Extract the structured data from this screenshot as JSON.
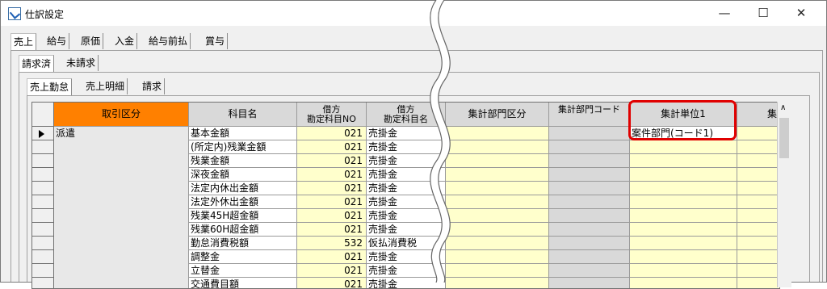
{
  "window": {
    "title": "仕訳設定",
    "minimize": "—",
    "maximize": "☐",
    "close": "✕"
  },
  "tabs_level1": [
    "売上",
    "給与",
    "原価",
    "入金",
    "給与前払",
    "賞与"
  ],
  "tabs_level2": [
    "請求済",
    "未請求"
  ],
  "tabs_level3": [
    "売上勤怠",
    "売上明細",
    "請求"
  ],
  "columns": {
    "category": "取引区分",
    "account": "科目名",
    "debit_no_1": "借方",
    "debit_no_2": "勘定科目NO",
    "debit_name_1": "借方",
    "debit_name_2": "勘定科目名",
    "dept_class": "集計部門区分",
    "dept_code": "集計部門コード",
    "unit1": "集計単位1",
    "unit2": "集"
  },
  "category_value": "派遣",
  "rows": [
    {
      "account": "基本金額",
      "no": "021",
      "name": "売掛金",
      "unit1": "案件部門(コード1)"
    },
    {
      "account": "(所定内)残業金額",
      "no": "021",
      "name": "売掛金",
      "unit1": ""
    },
    {
      "account": "残業金額",
      "no": "021",
      "name": "売掛金",
      "unit1": ""
    },
    {
      "account": "深夜金額",
      "no": "021",
      "name": "売掛金",
      "unit1": ""
    },
    {
      "account": "法定内休出金額",
      "no": "021",
      "name": "売掛金",
      "unit1": ""
    },
    {
      "account": "法定外休出金額",
      "no": "021",
      "name": "売掛金",
      "unit1": ""
    },
    {
      "account": "残業45H超金額",
      "no": "021",
      "name": "売掛金",
      "unit1": ""
    },
    {
      "account": "残業60H超金額",
      "no": "021",
      "name": "売掛金",
      "unit1": ""
    },
    {
      "account": "勤怠消費税額",
      "no": "532",
      "name": "仮払消費税",
      "unit1": ""
    },
    {
      "account": "調整金",
      "no": "021",
      "name": "売掛金",
      "unit1": ""
    },
    {
      "account": "立替金",
      "no": "021",
      "name": "売掛金",
      "unit1": ""
    },
    {
      "account": "交通費目額",
      "no": "021",
      "name": "売掛金",
      "unit1": ""
    }
  ],
  "colors": {
    "selected_header": "#ff8000",
    "input_cell": "#ffffcc",
    "highlight": "#e00000"
  }
}
